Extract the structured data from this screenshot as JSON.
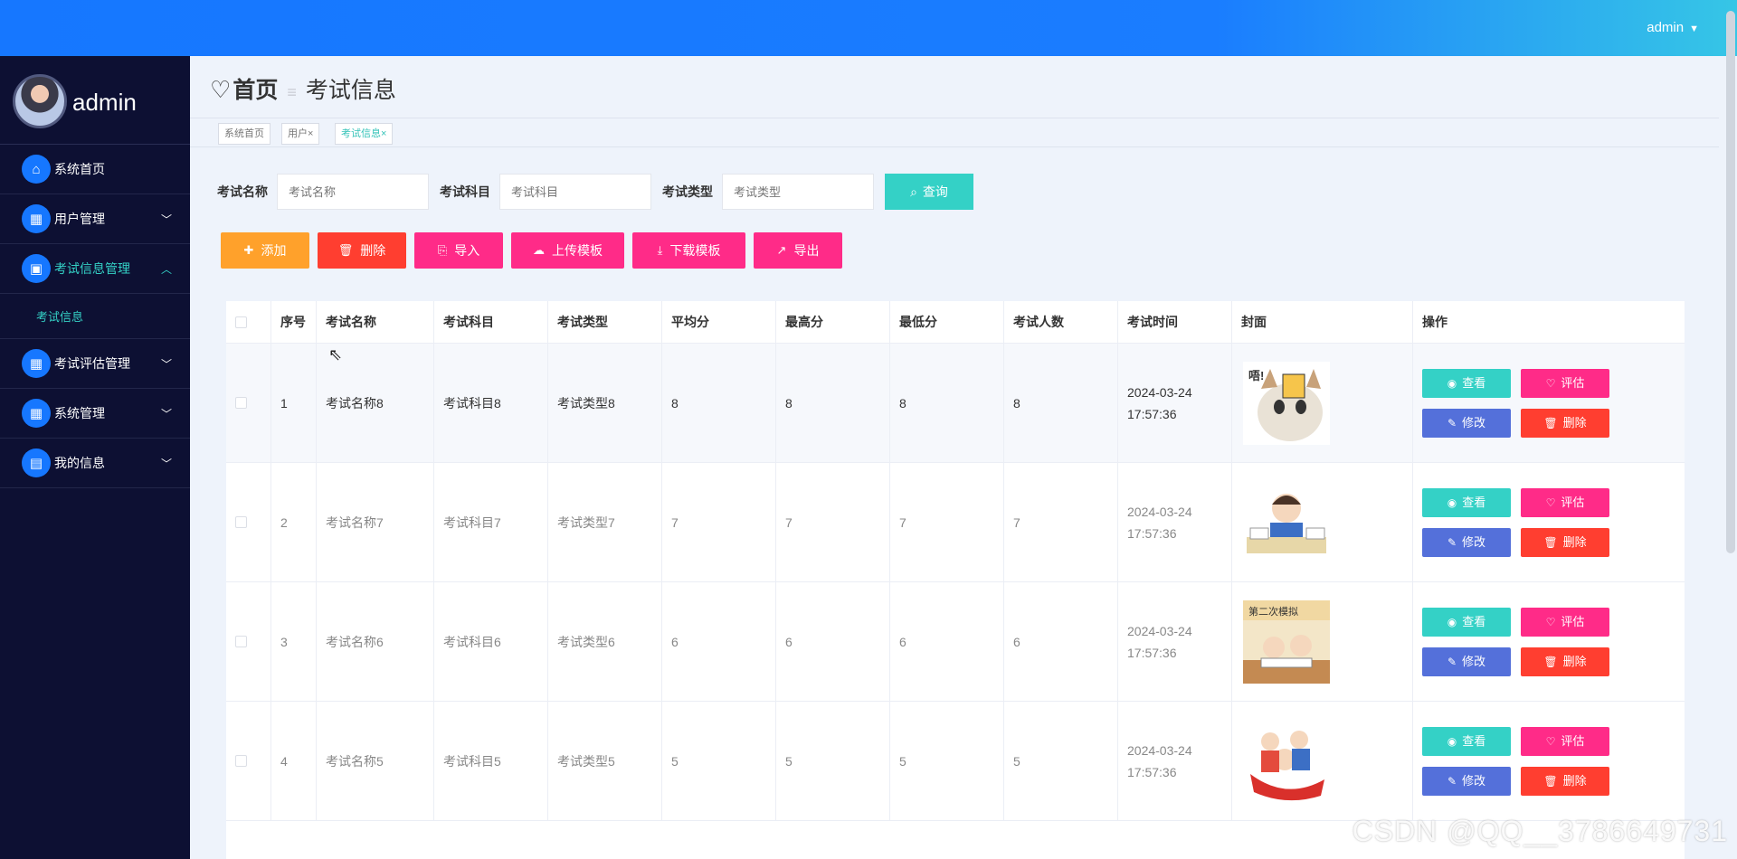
{
  "topbar": {
    "user_label": "admin",
    "caret": "▼"
  },
  "sidebar": {
    "username": "admin",
    "items": [
      {
        "label": "系统首页",
        "icon": "home-icon",
        "glyph": "⌂",
        "arrow": ""
      },
      {
        "label": "用户管理",
        "icon": "grid-icon",
        "glyph": "▦",
        "arrow": "﹀"
      },
      {
        "label": "考试信息管理",
        "icon": "briefcase-icon",
        "glyph": "▣",
        "arrow": "︿"
      },
      {
        "label": "考试评估管理",
        "icon": "apps-icon",
        "glyph": "▦",
        "arrow": "﹀"
      },
      {
        "label": "系统管理",
        "icon": "apps-icon",
        "glyph": "▦",
        "arrow": "﹀"
      },
      {
        "label": "我的信息",
        "icon": "wallet-icon",
        "glyph": "▤",
        "arrow": "﹀"
      }
    ],
    "submenu_label": "考试信息"
  },
  "breadcrumb": {
    "home": "首页",
    "separator": "≡",
    "current": "考试信息"
  },
  "tags": [
    {
      "label": "系统首页"
    },
    {
      "label": "用户×"
    },
    {
      "label": "考试信息×"
    }
  ],
  "search": {
    "name_label": "考试名称",
    "name_placeholder": "考试名称",
    "subject_label": "考试科目",
    "subject_placeholder": "考试科目",
    "type_label": "考试类型",
    "type_placeholder": "考试类型",
    "query_label": "查询"
  },
  "actions": {
    "add": "添加",
    "delete": "删除",
    "import": "导入",
    "upload_template": "上传模板",
    "download_template": "下载模板",
    "export": "导出"
  },
  "colors": {
    "teal": "#34d1c6",
    "orange": "#ffa12b",
    "red": "#ff3e30",
    "pink": "#ff2b88",
    "blue": "#5470da"
  },
  "table": {
    "headers": [
      "序号",
      "考试名称",
      "考试科目",
      "考试类型",
      "平均分",
      "最高分",
      "最低分",
      "考试人数",
      "考试时间",
      "封面",
      "操作"
    ],
    "rows": [
      {
        "no": "1",
        "name": "考试名称8",
        "subject": "考试科目8",
        "type": "考试类型8",
        "avg": "8",
        "max": "8",
        "min": "8",
        "count": "8",
        "time": "2024-03-24 17:57:36",
        "cover": "cat-sticker-image"
      },
      {
        "no": "2",
        "name": "考试名称7",
        "subject": "考试科目7",
        "type": "考试类型7",
        "avg": "7",
        "max": "7",
        "min": "7",
        "count": "7",
        "time": "2024-03-24 17:57:36",
        "cover": "student-studying-image"
      },
      {
        "no": "3",
        "name": "考试名称6",
        "subject": "考试科目6",
        "type": "考试类型6",
        "avg": "6",
        "max": "6",
        "min": "6",
        "count": "6",
        "time": "2024-03-24 17:57:36",
        "cover": "exam-desk-image"
      },
      {
        "no": "4",
        "name": "考试名称5",
        "subject": "考试科目5",
        "type": "考试类型5",
        "avg": "5",
        "max": "5",
        "min": "5",
        "count": "5",
        "time": "2024-03-24 17:57:36",
        "cover": "cheering-kids-image"
      }
    ],
    "ops": {
      "view": "查看",
      "evaluate": "评估",
      "edit": "修改",
      "delete": "删除"
    }
  },
  "watermark": "CSDN @QQ__3786649731"
}
